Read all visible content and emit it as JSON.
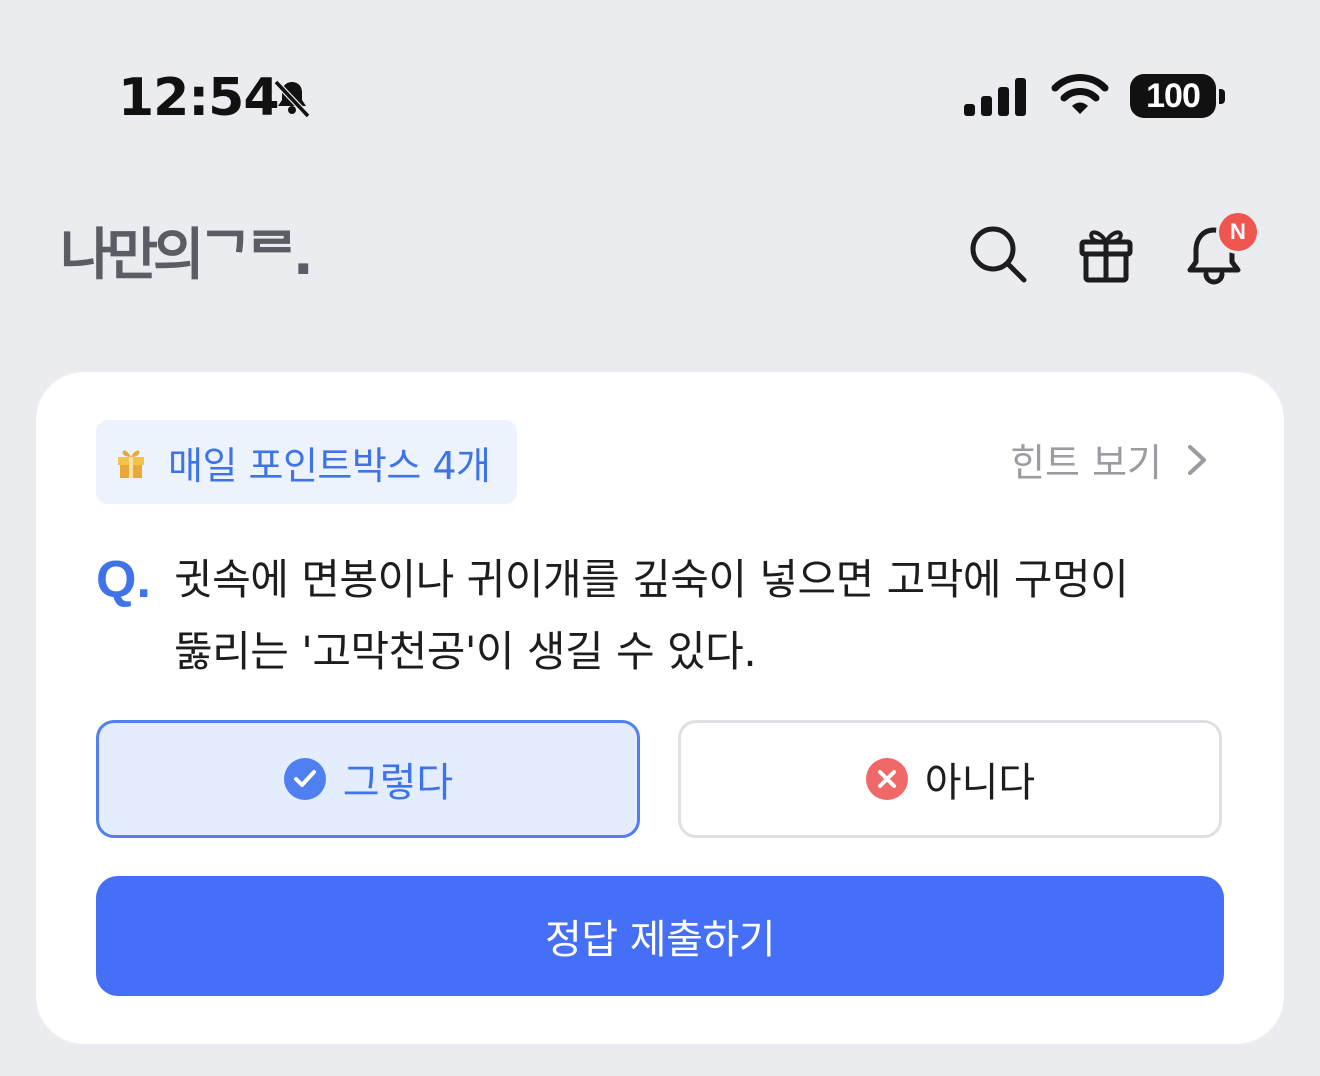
{
  "status_bar": {
    "time": "12:54",
    "battery_level": "100",
    "icons": [
      "bell-slash-icon",
      "signal-icon",
      "wifi-icon",
      "battery-icon"
    ]
  },
  "header": {
    "logo_text": "나만의ᄀᄅ.",
    "notification_badge": "N",
    "icons": [
      "search-icon",
      "gift-icon",
      "bell-icon"
    ]
  },
  "quiz": {
    "points_badge": "매일 포인트박스 4개",
    "hint_label": "힌트 보기",
    "question_prefix": "Q.",
    "question_line1": "귓속에 면봉이나 귀이개를 깊숙이 넣으면 고막에 구멍이",
    "question_line2": "뚫리는 '고막천공'이 생길 수 있다.",
    "answer_yes": "그렇다",
    "answer_no": "아니다",
    "selected_answer": "그렇다",
    "submit_label": "정답 제출하기"
  },
  "colors": {
    "accent": "#456ff6",
    "accent_text": "#3e73ea",
    "badge_red": "#f05650",
    "background": "#ebecf0"
  }
}
